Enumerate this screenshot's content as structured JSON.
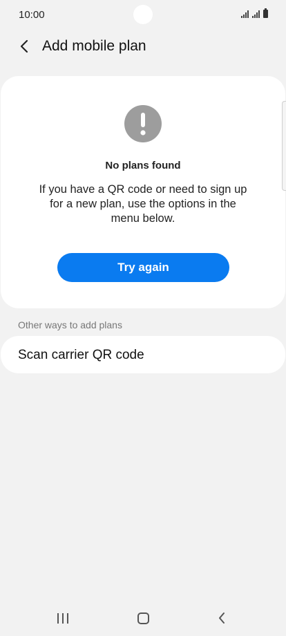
{
  "status_bar": {
    "time": "10:00"
  },
  "header": {
    "title": "Add mobile plan"
  },
  "main_card": {
    "icon": "exclamation-icon",
    "title": "No plans found",
    "description": "If you have a QR code or need to sign up for a new plan, use the options in the menu below.",
    "try_again_label": "Try again"
  },
  "other_ways": {
    "section_title": "Other ways to add plans",
    "items": [
      {
        "label": "Scan carrier QR code"
      }
    ]
  },
  "colors": {
    "accent": "#0a7bf0",
    "background": "#f2f2f2",
    "card": "#ffffff",
    "icon_gray": "#9d9d9d"
  }
}
